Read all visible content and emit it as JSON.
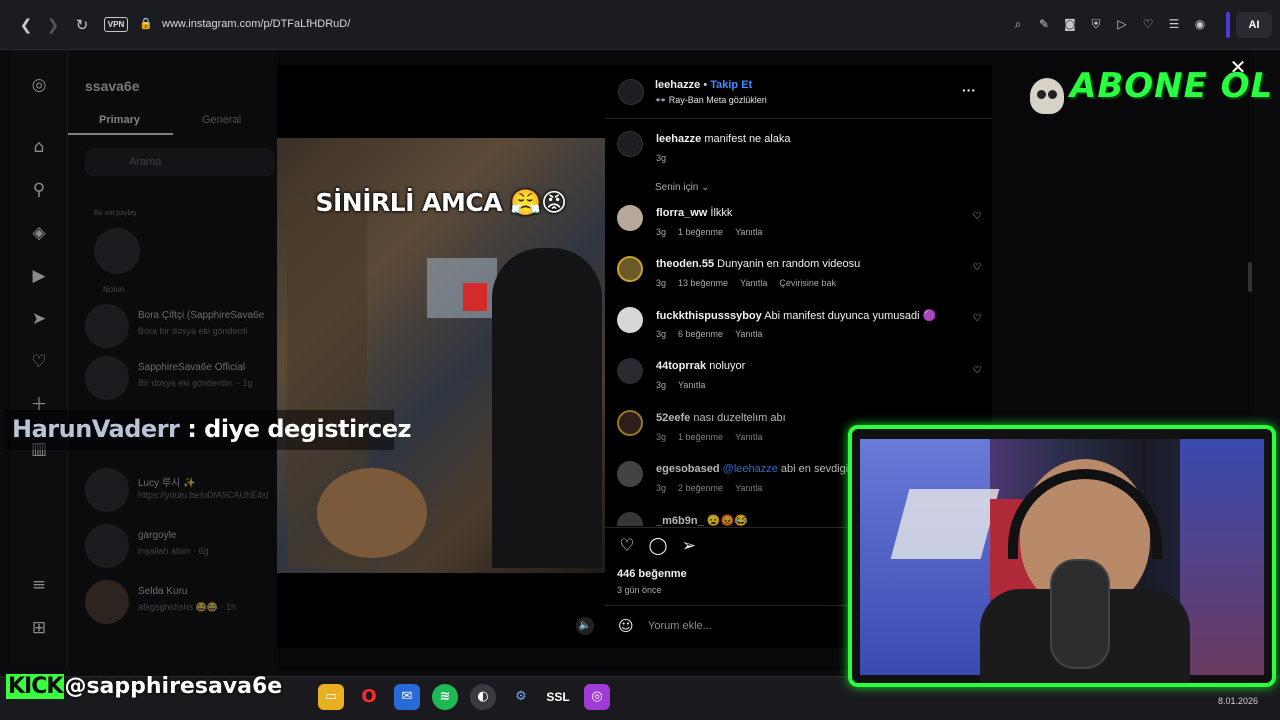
{
  "browser": {
    "url": "www.instagram.com/p/DTFaLfHDRuD/",
    "vpn_label": "VPN",
    "ai_label": "AI"
  },
  "dm_panel": {
    "username": "ssava6e",
    "tab_primary": "Primary",
    "tab_general": "General",
    "search_placeholder": "Arama",
    "note_label": "Bir not paylaş",
    "note_caption": "Notun",
    "conversations": [
      {
        "name": "Bora Çiftçi (SapphireSava6e",
        "sub": "Bora bir dosya eki gönderdi"
      },
      {
        "name": "SapphireSava6e Official",
        "sub": "Bir dosya eki gönderdin. · 1g"
      },
      {
        "name": "Lucy 루시 ✨",
        "sub": "https://youtu.be/uDfA9CAUhE4si"
      },
      {
        "name": "gargoyle",
        "sub": "inşallah abim · 6g"
      },
      {
        "name": "Selda Kuru",
        "sub": "afsgsghshshs 😂😂 · 1h"
      }
    ]
  },
  "video": {
    "caption": "SİNİRLİ AMCA 😤😡"
  },
  "post": {
    "author": "leehazze",
    "follow": "Takip Et",
    "dot": "•",
    "subtitle": "👓 Ray-Ban Meta gözlükleri",
    "more": "···",
    "caption_user": "leehazze",
    "caption_text": "manifest ne alaka",
    "caption_time": "3g",
    "sort_label": "Senin için",
    "likes": "446 beğenme",
    "posted": "3 gün önce",
    "comment_placeholder": "Yorum ekle..."
  },
  "comments": [
    {
      "user": "florra_ww",
      "text": "İlkkk",
      "time": "3g",
      "likes": "1 beğenme",
      "reply": "Yanıtla",
      "extra": ""
    },
    {
      "user": "theoden.55",
      "text": "Dunyanin en random videosu",
      "time": "3g",
      "likes": "13 beğenme",
      "reply": "Yanıtla",
      "extra": "Çevirisine bak"
    },
    {
      "user": "fuckkthispusssyboy",
      "text": "Abi manifest duyunca yumusadi 🟣",
      "time": "3g",
      "likes": "6 beğenme",
      "reply": "Yanıtla",
      "extra": ""
    },
    {
      "user": "44toprrak",
      "text": "noluyor",
      "time": "3g",
      "likes": "",
      "reply": "Yanıtla",
      "extra": ""
    },
    {
      "user": "52eefe",
      "text": "nası duzeltelım abı",
      "time": "3g",
      "likes": "1 beğenme",
      "reply": "Yanıtla",
      "extra": ""
    },
    {
      "user": "egesobased",
      "text": "abi en sevdigin",
      "mention": "@leehazze",
      "time": "3g",
      "likes": "2 beğenme",
      "reply": "Yanıtla",
      "extra": ""
    },
    {
      "user": "_m6b9n_",
      "text": "😦😡😂",
      "time": "",
      "likes": "",
      "reply": "",
      "extra": ""
    }
  ],
  "overlays": {
    "abone": "ABONE OL",
    "harun_name": "HarunVaderr",
    "harun_msg": " : diye degistircez",
    "kick_brand": "KICK",
    "kick_handle": "@sapphiresava6e",
    "date": "8.01.2026",
    "ssl_label": "SSL"
  },
  "colors": {
    "accent_green": "#29ff3c",
    "instagram_blue": "#3f8cff"
  }
}
